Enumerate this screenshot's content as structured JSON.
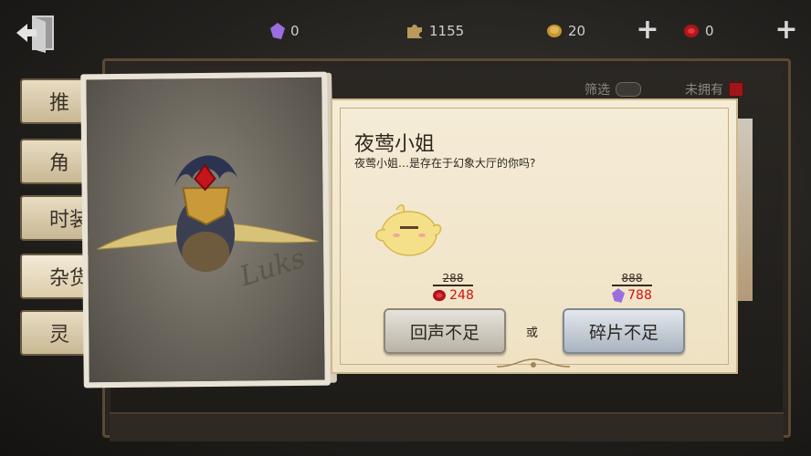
{
  "top_bar": {
    "currencies": [
      {
        "icon": "purple-fragment-icon",
        "value": "0"
      },
      {
        "icon": "puzzle-piece-icon",
        "value": "1155"
      },
      {
        "icon": "gold-coin-icon",
        "value": "20"
      },
      {
        "icon": "red-echo-icon",
        "value": "0"
      }
    ],
    "plus_label": "+"
  },
  "filters": {
    "filter_label": "筛选",
    "unowned_label": "未拥有"
  },
  "side_tabs": [
    {
      "label": "推"
    },
    {
      "label": "角"
    },
    {
      "label": "时装"
    },
    {
      "label": "杂货"
    },
    {
      "label": "灵"
    }
  ],
  "card": {
    "signature_text": "Luks"
  },
  "dialog": {
    "title": "夜莺小姐",
    "subtitle": "夜莺小姐…是存在于幻象大厅的你吗?",
    "echo_price": {
      "old": "288",
      "new": "248",
      "icon": "red-echo-icon"
    },
    "fragment_price": {
      "old": "888",
      "new": "788",
      "icon": "purple-fragment-icon"
    },
    "echo_button": "回声不足",
    "or_label": "或",
    "fragment_button": "碎片不足"
  },
  "colors": {
    "accent_red": "#d21010",
    "paper": "#f5ecd7",
    "frame": "#5a4a35"
  }
}
